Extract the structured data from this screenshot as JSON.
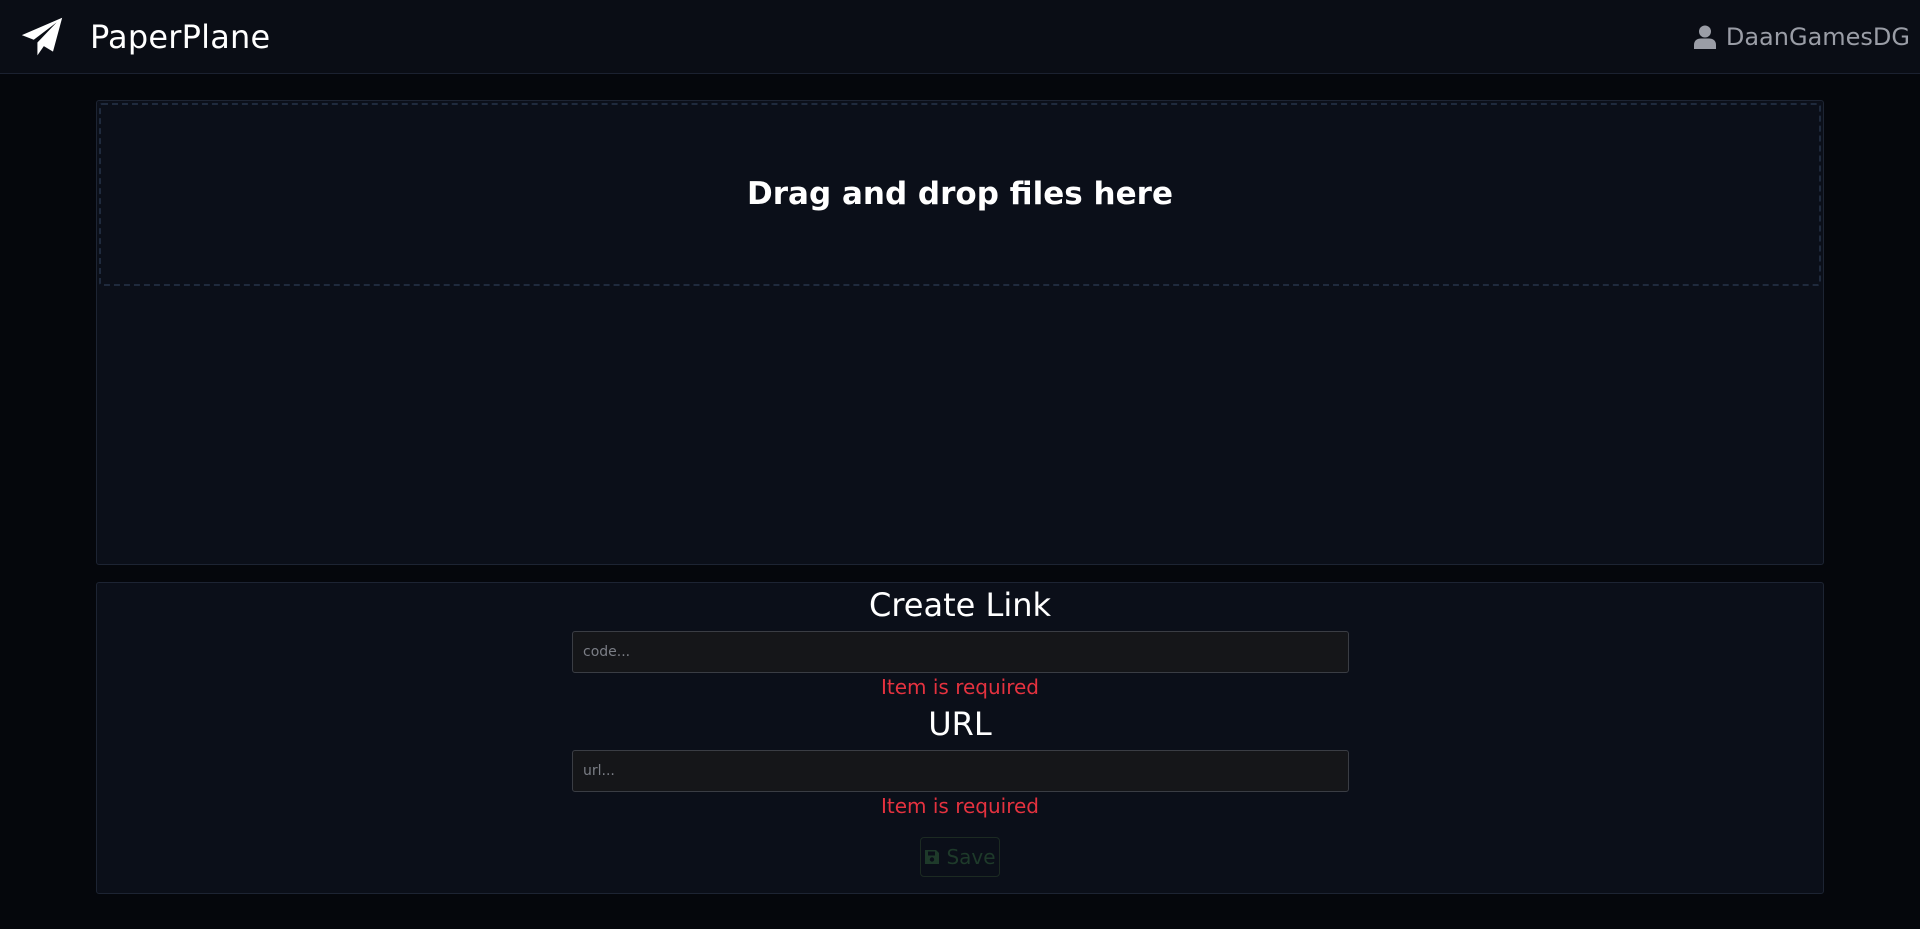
{
  "header": {
    "brand": "PaperPlane",
    "logo_icon": "paper-plane-icon",
    "user_icon": "user-icon",
    "username": "DaanGamesDG"
  },
  "upload": {
    "drop_text": "Drag and drop files here"
  },
  "create_link": {
    "title": "Create Link",
    "code": {
      "placeholder": "code...",
      "value": "",
      "error": "Item is required"
    },
    "url_title": "URL",
    "url": {
      "placeholder": "url...",
      "value": "",
      "error": "Item is required"
    },
    "save_label": "Save",
    "save_icon": "floppy-disk-icon",
    "save_disabled": true
  },
  "colors": {
    "background": "#05070c",
    "navbar": "#0a0d15",
    "card": "#0b0f19",
    "error": "#e5323f",
    "save_disabled": "#1e3a2a"
  }
}
